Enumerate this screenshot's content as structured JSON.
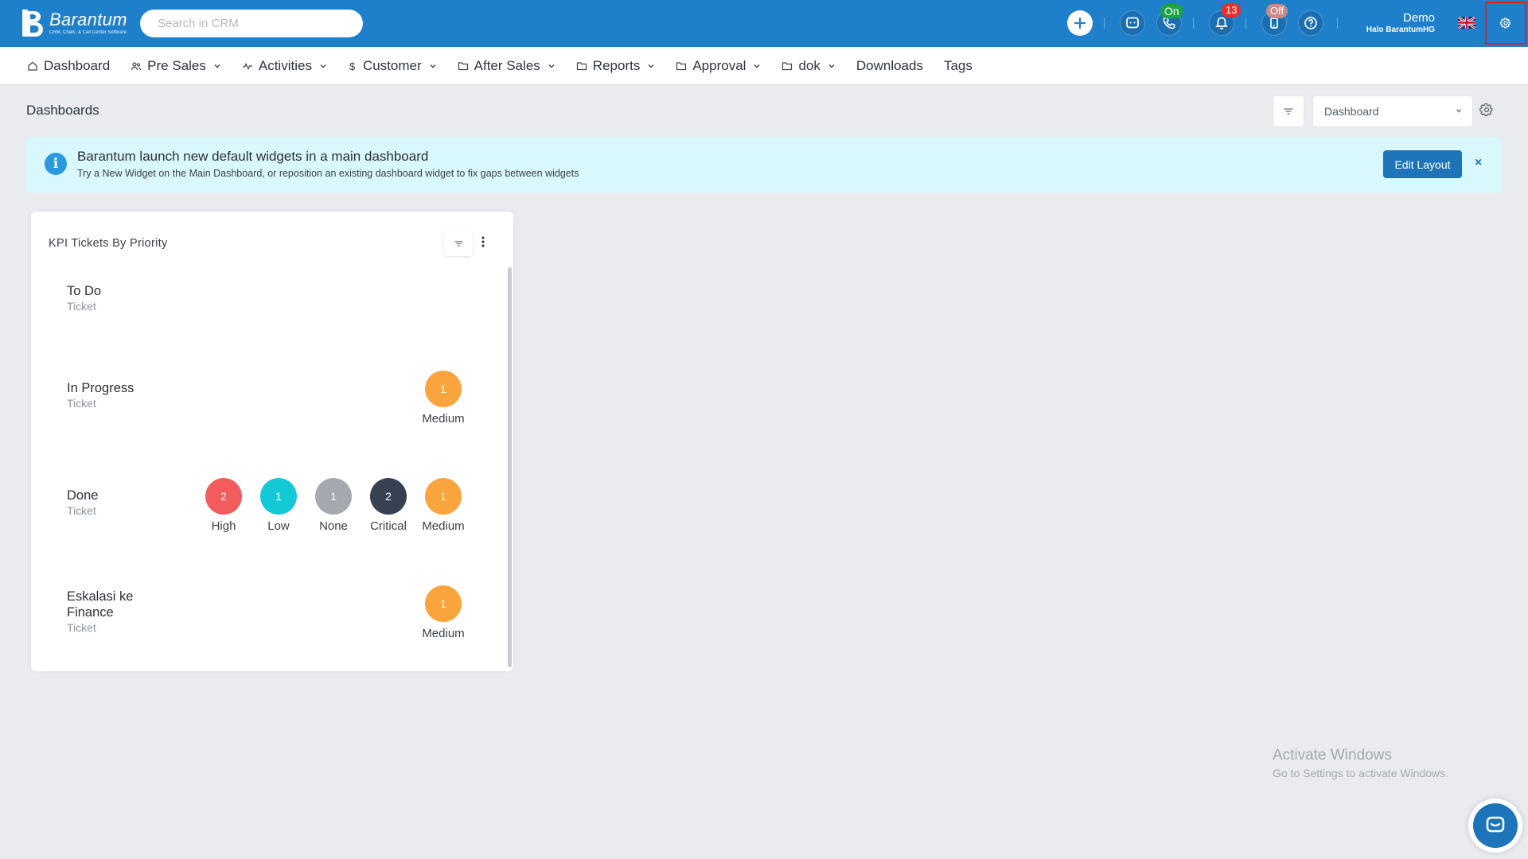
{
  "app": {
    "logo_name": "Barantum",
    "logo_tagline": "CRM, Chats, & Call Center Software"
  },
  "topbar": {
    "search_placeholder": "Search in CRM",
    "phone_status": "On",
    "notification_count": "13",
    "agent_status": "Off",
    "user_name": "Demo",
    "user_company": "Halo BarantumHG"
  },
  "nav": {
    "items": [
      {
        "label": "Dashboard",
        "icon": "home-icon",
        "dropdown": false
      },
      {
        "label": "Pre Sales",
        "icon": "users-icon",
        "dropdown": true
      },
      {
        "label": "Activities",
        "icon": "activity-icon",
        "dropdown": true
      },
      {
        "label": "Customer",
        "icon": "dollar-icon",
        "dropdown": true
      },
      {
        "label": "After Sales",
        "icon": "folder-icon",
        "dropdown": true
      },
      {
        "label": "Reports",
        "icon": "folder-icon",
        "dropdown": true
      },
      {
        "label": "Approval",
        "icon": "folder-icon",
        "dropdown": true
      },
      {
        "label": "dok",
        "icon": "folder-icon",
        "dropdown": true
      },
      {
        "label": "Downloads",
        "icon": "",
        "dropdown": false
      },
      {
        "label": "Tags",
        "icon": "",
        "dropdown": false
      }
    ]
  },
  "page": {
    "title": "Dashboards",
    "dashboard_select_value": "Dashboard"
  },
  "banner": {
    "title": "Barantum launch new default widgets in a main dashboard",
    "subtitle": "Try a New Widget on the Main Dashboard, or reposition an existing dashboard widget to fix gaps between widgets",
    "button_label": "Edit Layout",
    "close_symbol": "×"
  },
  "widget": {
    "title": "KPI Tickets By Priority",
    "rows": [
      {
        "status": "To Do",
        "sub": "Ticket",
        "items": []
      },
      {
        "status": "In Progress",
        "sub": "Ticket",
        "items": [
          {
            "count": "1",
            "label": "Medium",
            "color": "#f9a43c"
          }
        ]
      },
      {
        "status": "Done",
        "sub": "Ticket",
        "items": [
          {
            "count": "2",
            "label": "High",
            "color": "#f25c5c"
          },
          {
            "count": "1",
            "label": "Low",
            "color": "#13c9d6"
          },
          {
            "count": "1",
            "label": "None",
            "color": "#a4a9b0"
          },
          {
            "count": "2",
            "label": "Critical",
            "color": "#364152"
          },
          {
            "count": "1",
            "label": "Medium",
            "color": "#f9a43c"
          }
        ]
      },
      {
        "status": "Eskalasi ke Finance",
        "sub": "Ticket",
        "items": [
          {
            "count": "1",
            "label": "Medium",
            "color": "#f9a43c"
          }
        ]
      }
    ]
  },
  "watermark": {
    "line1": "Activate Windows",
    "line2": "Go to Settings to activate Windows."
  },
  "colors": {
    "topbar": "#1e7fcb",
    "primary_button": "#1d74b8",
    "banner_bg": "#d9f8fd",
    "highlight_border": "#e2231a"
  }
}
